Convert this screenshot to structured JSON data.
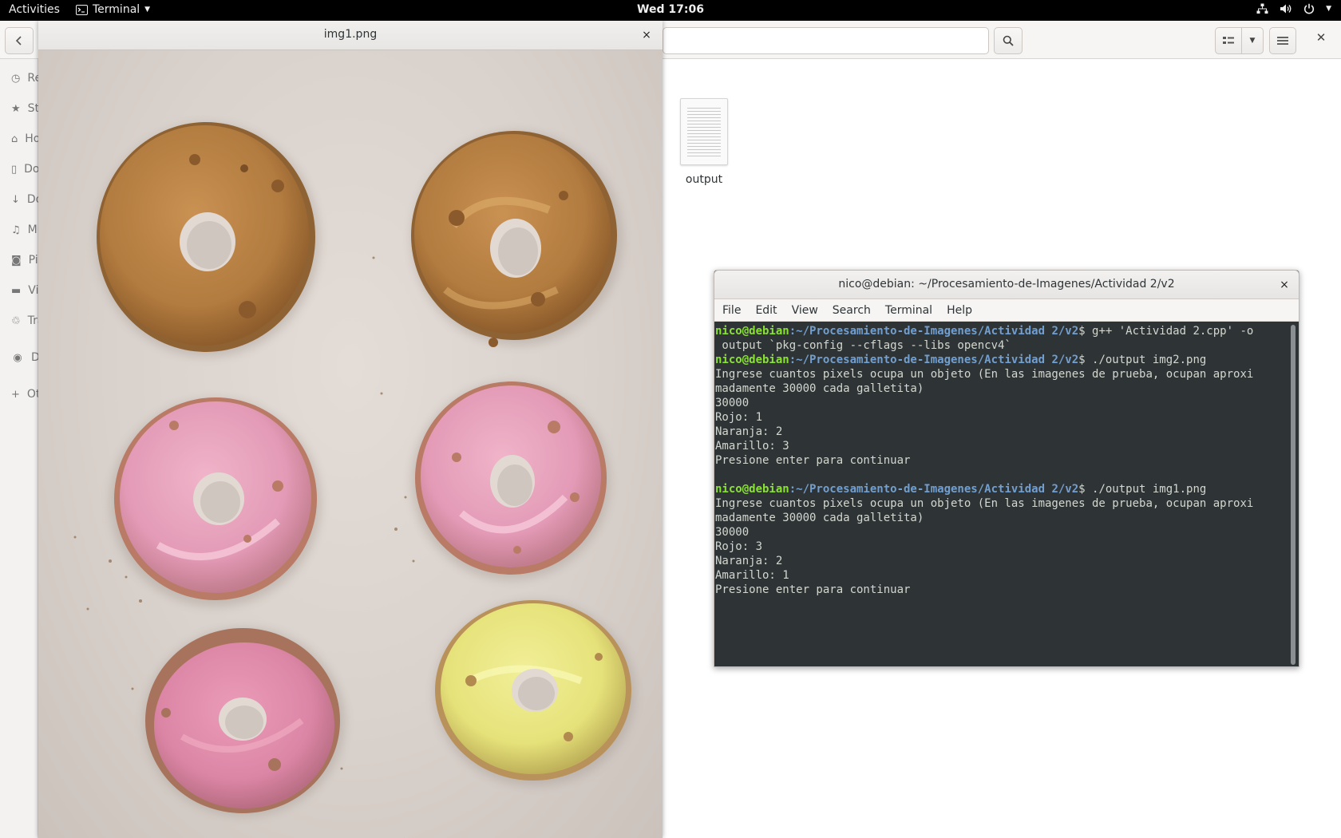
{
  "topbar": {
    "activities": "Activities",
    "app_name": "Terminal",
    "clock": "Wed 17:06"
  },
  "files": {
    "sidebar_items": [
      {
        "label": "Recent",
        "icon": "clock-icon"
      },
      {
        "label": "Starred",
        "icon": "star-icon"
      },
      {
        "label": "Home",
        "icon": "home-icon"
      },
      {
        "label": "Documents",
        "icon": "document-icon"
      },
      {
        "label": "Downloads",
        "icon": "download-icon"
      },
      {
        "label": "Music",
        "icon": "music-icon"
      },
      {
        "label": "Pictures",
        "icon": "camera-icon"
      },
      {
        "label": "Videos",
        "icon": "video-icon"
      },
      {
        "label": "Trash",
        "icon": "trash-icon"
      },
      {
        "label": "D",
        "icon": "disk-icon"
      },
      {
        "label": "Other Locations",
        "icon": "plus-icon"
      }
    ],
    "file_name": "output"
  },
  "viewer": {
    "title": "img1.png",
    "close_glyph": "×"
  },
  "terminal": {
    "title": "nico@debian: ~/Procesamiento-de-Imagenes/Actividad 2/v2",
    "close_glyph": "×",
    "menu": [
      "File",
      "Edit",
      "View",
      "Search",
      "Terminal",
      "Help"
    ],
    "prompt_user": "nico@debian",
    "prompt_path": ":~/Procesamiento-de-Imagenes/Actividad 2/v2",
    "cmd1": "$ g++ 'Actividad 2.cpp' -o",
    "cmd1_cont": " output `pkg-config --cflags --libs opencv4`",
    "cmd2": "$ ./output img2.png",
    "run1": [
      "Ingrese cuantos pixels ocupa un objeto (En las imagenes de prueba, ocupan aproxi",
      "madamente 30000 cada galletita)",
      "30000",
      "Rojo: 1",
      "Naranja: 2",
      "Amarillo: 3",
      "Presione enter para continuar",
      ""
    ],
    "cmd3": "$ ./output img1.png",
    "run2": [
      "Ingrese cuantos pixels ocupa un objeto (En las imagenes de prueba, ocupan aproxi",
      "madamente 30000 cada galletita)",
      "30000",
      "Rojo: 3",
      "Naranja: 2",
      "Amarillo: 1",
      "Presione enter para continuar"
    ]
  },
  "colors": {
    "terminal_bg": "#2e3436",
    "prompt_user": "#8ae234",
    "prompt_path": "#729fcf",
    "cookie_brown": "#b07a3e",
    "cookie_pink": "#e39ab6",
    "cookie_yellow": "#e8e57a"
  }
}
